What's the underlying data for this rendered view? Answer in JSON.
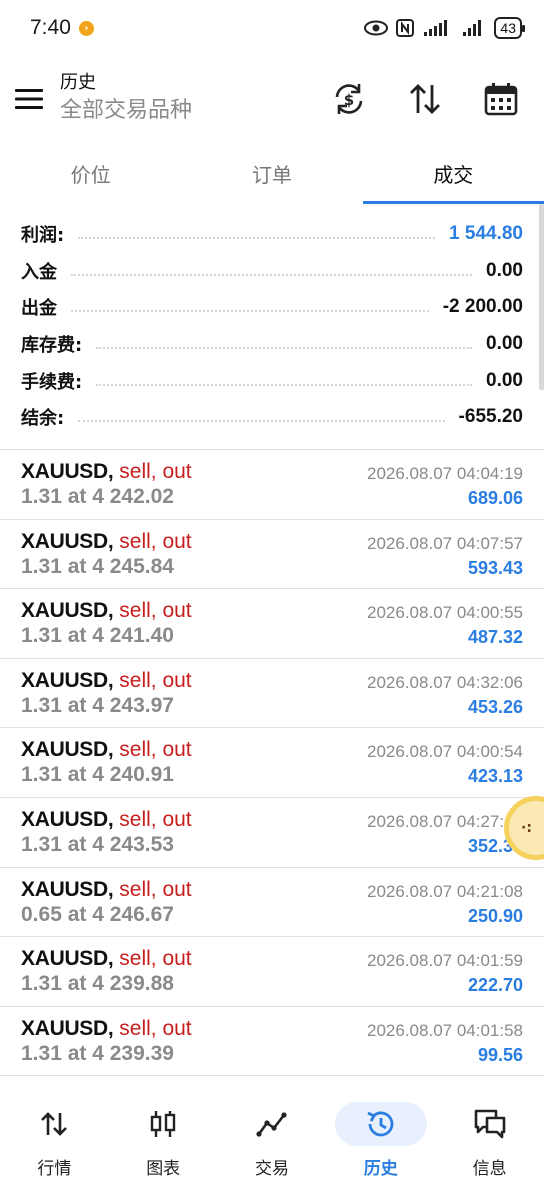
{
  "status_bar": {
    "time": "7:40",
    "battery": "43"
  },
  "header": {
    "title": "历史",
    "subtitle": "全部交易品种"
  },
  "tabs": [
    {
      "label": "价位",
      "active": false
    },
    {
      "label": "订单",
      "active": false
    },
    {
      "label": "成交",
      "active": true
    }
  ],
  "summary": [
    {
      "label": "利润:",
      "value": "1 544.80",
      "highlight": true
    },
    {
      "label": "入金",
      "value": "0.00",
      "highlight": false
    },
    {
      "label": "出金",
      "value": "-2 200.00",
      "highlight": false
    },
    {
      "label": "库存费:",
      "value": "0.00",
      "highlight": false
    },
    {
      "label": "手续费:",
      "value": "0.00",
      "highlight": false
    },
    {
      "label": "结余:",
      "value": "-655.20",
      "highlight": false
    }
  ],
  "deals": [
    {
      "symbol": "XAUUSD,",
      "side": "sell, out",
      "volume_price": "1.31 at 4 242.02",
      "time": "2026.08.07 04:04:19",
      "profit": "689.06"
    },
    {
      "symbol": "XAUUSD,",
      "side": "sell, out",
      "volume_price": "1.31 at 4 245.84",
      "time": "2026.08.07 04:07:57",
      "profit": "593.43"
    },
    {
      "symbol": "XAUUSD,",
      "side": "sell, out",
      "volume_price": "1.31 at 4 241.40",
      "time": "2026.08.07 04:00:55",
      "profit": "487.32"
    },
    {
      "symbol": "XAUUSD,",
      "side": "sell, out",
      "volume_price": "1.31 at 4 243.97",
      "time": "2026.08.07 04:32:06",
      "profit": "453.26"
    },
    {
      "symbol": "XAUUSD,",
      "side": "sell, out",
      "volume_price": "1.31 at 4 240.91",
      "time": "2026.08.07 04:00:54",
      "profit": "423.13"
    },
    {
      "symbol": "XAUUSD,",
      "side": "sell, out",
      "volume_price": "1.31 at 4 243.53",
      "time": "2026.08.07 04:27:16",
      "profit": "352.39"
    },
    {
      "symbol": "XAUUSD,",
      "side": "sell, out",
      "volume_price": "0.65 at 4 246.67",
      "time": "2026.08.07 04:21:08",
      "profit": "250.90"
    },
    {
      "symbol": "XAUUSD,",
      "side": "sell, out",
      "volume_price": "1.31 at 4 239.88",
      "time": "2026.08.07 04:01:59",
      "profit": "222.70"
    },
    {
      "symbol": "XAUUSD,",
      "side": "sell, out",
      "volume_price": "1.31 at 4 239.39",
      "time": "2026.08.07 04:01:58",
      "profit": "99.56"
    }
  ],
  "bottom_nav": [
    {
      "label": "行情",
      "icon": "quotes-arrows-icon",
      "active": false
    },
    {
      "label": "图表",
      "icon": "candlestick-chart-icon",
      "active": false
    },
    {
      "label": "交易",
      "icon": "trade-line-icon",
      "active": false
    },
    {
      "label": "历史",
      "icon": "history-clock-icon",
      "active": true
    },
    {
      "label": "信息",
      "icon": "messages-icon",
      "active": false
    }
  ],
  "colors": {
    "accent": "#2a7de1",
    "sell": "#c81e1e",
    "muted": "#8a8a8a"
  }
}
